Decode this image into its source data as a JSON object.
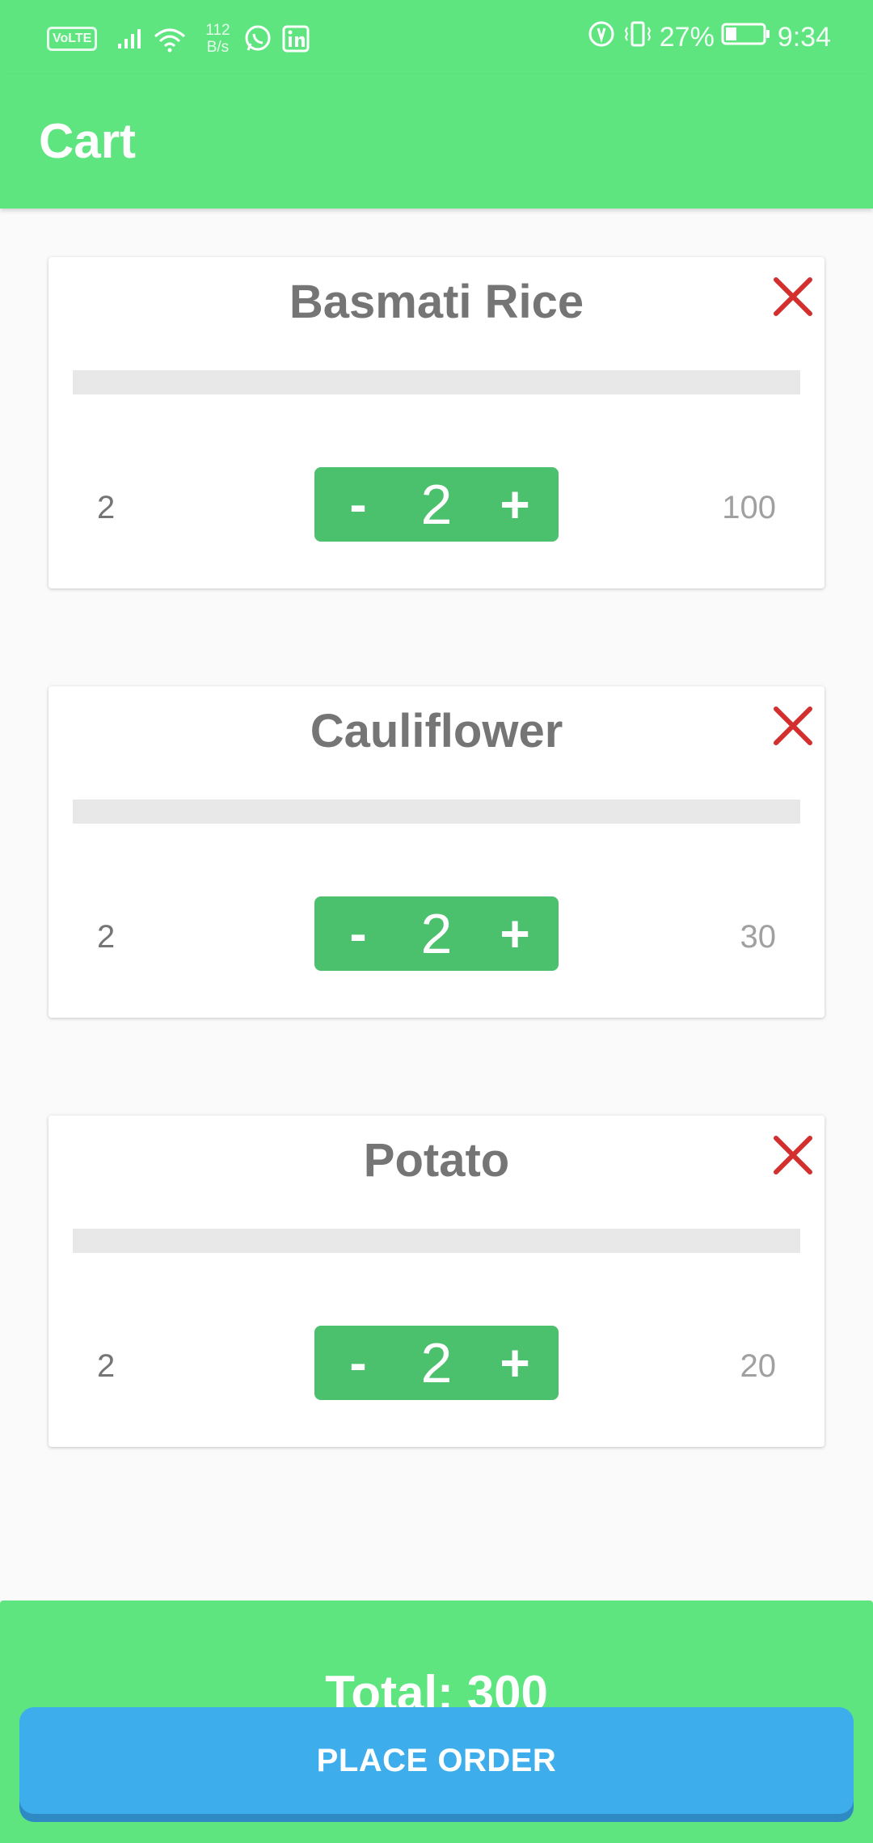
{
  "status_bar": {
    "volte": "VoLTE",
    "speed_value": "112",
    "speed_unit": "B/s",
    "battery": "27%",
    "time": "9:34",
    "icons": [
      "signal-icon",
      "wifi-icon",
      "whatsapp-icon",
      "linkedin-icon",
      "data-saver-icon",
      "vibrate-icon",
      "battery-icon"
    ]
  },
  "app_bar": {
    "title": "Cart"
  },
  "cart": {
    "items": [
      {
        "name": "Basmati Rice",
        "qty": "2",
        "stepper_value": "2",
        "minus": "-",
        "plus": "+",
        "price": "100"
      },
      {
        "name": "Cauliflower",
        "qty": "2",
        "stepper_value": "2",
        "minus": "-",
        "plus": "+",
        "price": "30"
      },
      {
        "name": "Potato",
        "qty": "2",
        "stepper_value": "2",
        "minus": "-",
        "plus": "+",
        "price": "20"
      }
    ]
  },
  "footer": {
    "total": "Total: 300",
    "order_button": "PLACE ORDER"
  },
  "colors": {
    "header": "#5ee580",
    "stepper": "#4bc06d",
    "remove_icon": "#d32f2f",
    "order_button": "#3eadec"
  }
}
